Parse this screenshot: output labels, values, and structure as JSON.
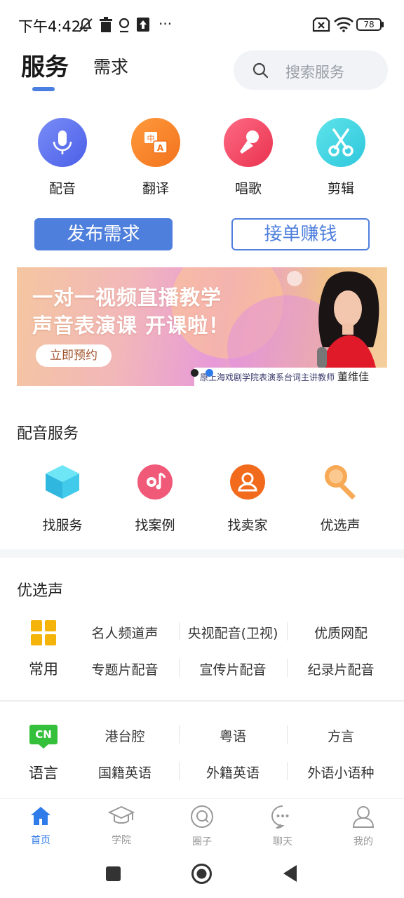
{
  "status_bar": {
    "time": "下午4:42",
    "battery": "78",
    "more": "···"
  },
  "header": {
    "tabs": [
      {
        "label": "服务",
        "active": true
      },
      {
        "label": "需求",
        "active": false
      }
    ],
    "search_placeholder": "搜索服务"
  },
  "quick_services": [
    {
      "label": "配音",
      "icon": "microphone-icon",
      "color": "#5b7cf0"
    },
    {
      "label": "翻译",
      "icon": "translate-icon",
      "color": "#f5822c"
    },
    {
      "label": "唱歌",
      "icon": "karaoke-mic-icon",
      "color": "#f0456a"
    },
    {
      "label": "剪辑",
      "icon": "scissors-icon",
      "color": "#3ed3e0"
    }
  ],
  "actions": {
    "publish": "发布需求",
    "earn": "接单赚钱"
  },
  "banner": {
    "headline_1": "一对一视频直播教学",
    "headline_2": "声音表演课  开课啦！",
    "cta": "立即预约",
    "caption": "原上海戏剧学院表演系台词主讲教师",
    "teacher_name": "董维佳",
    "active_dot": 1
  },
  "dubbing_section": {
    "title": "配音服务",
    "items": [
      {
        "label": "找服务",
        "icon": "cube-icon"
      },
      {
        "label": "找案例",
        "icon": "music-disc-icon"
      },
      {
        "label": "找卖家",
        "icon": "seller-icon"
      },
      {
        "label": "优选声",
        "icon": "microphone-icon"
      }
    ]
  },
  "selection": {
    "title": "优选声",
    "common": {
      "label": "常用",
      "icon": "grid-icon",
      "row1": [
        "名人频道声",
        "央视配音(卫视)",
        "优质网配"
      ],
      "row2": [
        "专题片配音",
        "宣传片配音",
        "纪录片配音"
      ]
    },
    "language": {
      "label": "语言",
      "badge": "CN",
      "row1": [
        "港台腔",
        "粤语",
        "方言"
      ],
      "row2": [
        "国籍英语",
        "外籍英语",
        "外语小语种"
      ]
    }
  },
  "bottom_nav": [
    {
      "label": "首页",
      "icon": "home-icon",
      "active": true
    },
    {
      "label": "学院",
      "icon": "graduation-cap-icon",
      "active": false
    },
    {
      "label": "圈子",
      "icon": "circle-icon",
      "active": false
    },
    {
      "label": "聊天",
      "icon": "chat-icon",
      "active": false
    },
    {
      "label": "我的",
      "icon": "user-icon",
      "active": false
    }
  ],
  "colors": {
    "accent": "#4f7fdd",
    "nav_active": "#2f7bea",
    "orange": "#f5822c"
  }
}
